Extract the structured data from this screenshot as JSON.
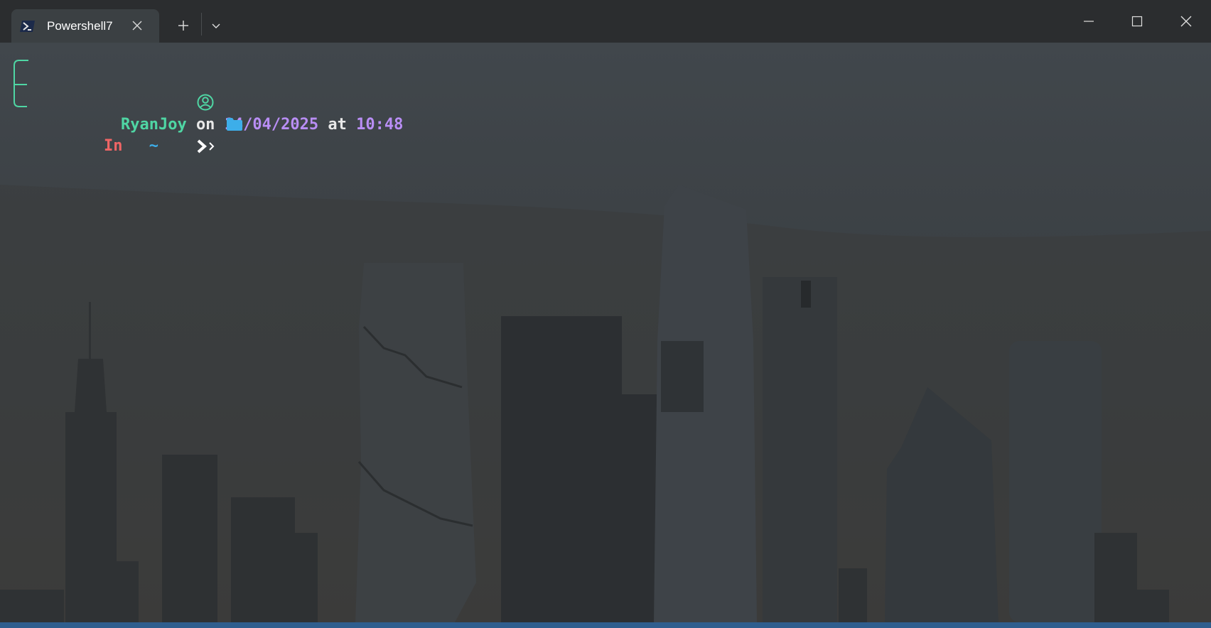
{
  "window": {
    "tab_title": "Powershell7",
    "tab_icon": "powershell-icon",
    "new_tab_icon": "plus-icon",
    "dropdown_icon": "chevron-down-icon",
    "controls": [
      "minimize-icon",
      "maximize-icon",
      "close-icon"
    ]
  },
  "prompt": {
    "user": "RyanJoy",
    "on_word": "on",
    "date": "14/04/2025",
    "at_word": "at",
    "time": "10:48",
    "in_word": "In",
    "path": "~",
    "user_icon": "user-circle-icon",
    "folder_icon": "folder-icon",
    "prompt_icon": "chevron-right-icon"
  },
  "colors": {
    "user": "#4fd6a4",
    "date_time": "#b98ef5",
    "in_word": "#f06565",
    "path": "#3daee9",
    "frame_lines": "#4fd6a4"
  }
}
